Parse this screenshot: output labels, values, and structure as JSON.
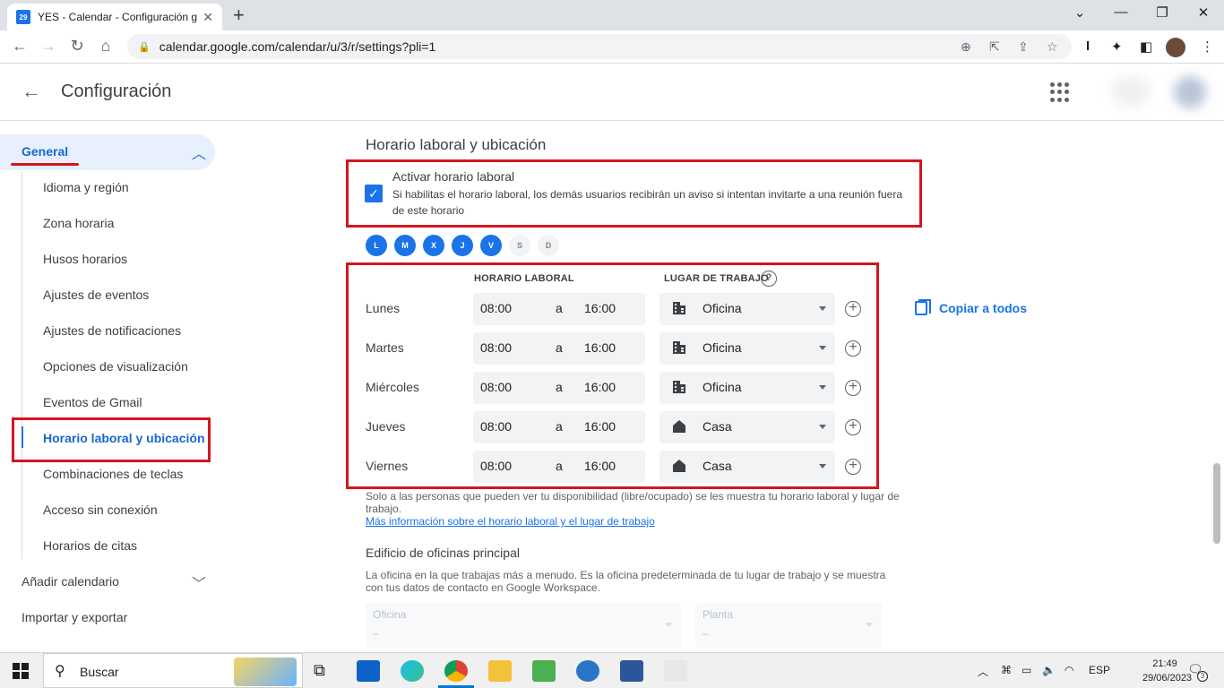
{
  "browser": {
    "tab_title": "YES - Calendar - Configuración g",
    "tab_favicon": "29",
    "url": "calendar.google.com/calendar/u/3/r/settings?pli=1"
  },
  "header": {
    "title": "Configuración"
  },
  "sidebar": {
    "general": "General",
    "items": [
      "Idioma y región",
      "Zona horaria",
      "Husos horarios",
      "Ajustes de eventos",
      "Ajustes de notificaciones",
      "Opciones de visualización",
      "Eventos de Gmail",
      "Horario laboral y ubicación",
      "Combinaciones de teclas",
      "Acceso sin conexión",
      "Horarios de citas"
    ],
    "add_calendar": "Añadir calendario",
    "import_export": "Importar y exportar"
  },
  "main": {
    "section_title": "Horario laboral y ubicación",
    "enable_label": "Activar horario laboral",
    "enable_desc": "Si habilitas el horario laboral, los demás usuarios recibirán un aviso si intentan invitarte a una reunión fuera de este horario",
    "enabled": true,
    "days": [
      {
        "letter": "L",
        "on": true
      },
      {
        "letter": "M",
        "on": true
      },
      {
        "letter": "X",
        "on": true
      },
      {
        "letter": "J",
        "on": true
      },
      {
        "letter": "V",
        "on": true
      },
      {
        "letter": "S",
        "on": false
      },
      {
        "letter": "D",
        "on": false
      }
    ],
    "col_hours": "HORARIO LABORAL",
    "col_place": "LUGAR DE TRABAJO",
    "help_icon": "?",
    "rows": [
      {
        "day": "Lunes",
        "from": "08:00",
        "sep": "a",
        "to": "16:00",
        "place": "Oficina",
        "icon": "building-icon"
      },
      {
        "day": "Martes",
        "from": "08:00",
        "sep": "a",
        "to": "16:00",
        "place": "Oficina",
        "icon": "building-icon"
      },
      {
        "day": "Miércoles",
        "from": "08:00",
        "sep": "a",
        "to": "16:00",
        "place": "Oficina",
        "icon": "building-icon"
      },
      {
        "day": "Jueves",
        "from": "08:00",
        "sep": "a",
        "to": "16:00",
        "place": "Casa",
        "icon": "home-icon"
      },
      {
        "day": "Viernes",
        "from": "08:00",
        "sep": "a",
        "to": "16:00",
        "place": "Casa",
        "icon": "home-icon"
      }
    ],
    "copy_all": "Copiar a todos",
    "note": "Solo a las personas que pueden ver tu disponibilidad (libre/ocupado) se les muestra tu horario laboral y lugar de trabajo.",
    "more_link": "Más información sobre el horario laboral y el lugar de trabajo",
    "office_title": "Edificio de oficinas principal",
    "office_desc": "La oficina en la que trabajas más a menudo. Es la oficina predeterminada de tu lugar de trabajo y se muestra con tus datos de contacto en Google Workspace.",
    "office_field_label": "Oficina",
    "office_field_value": "–",
    "floor_field_label": "Planta",
    "floor_field_value": "–"
  },
  "taskbar": {
    "search": "Buscar",
    "lang": "ESP",
    "time": "21:49",
    "date": "29/06/2023",
    "notif_count": "3"
  },
  "colors": {
    "accent": "#1a73e8",
    "highlight": "#d4161f"
  }
}
